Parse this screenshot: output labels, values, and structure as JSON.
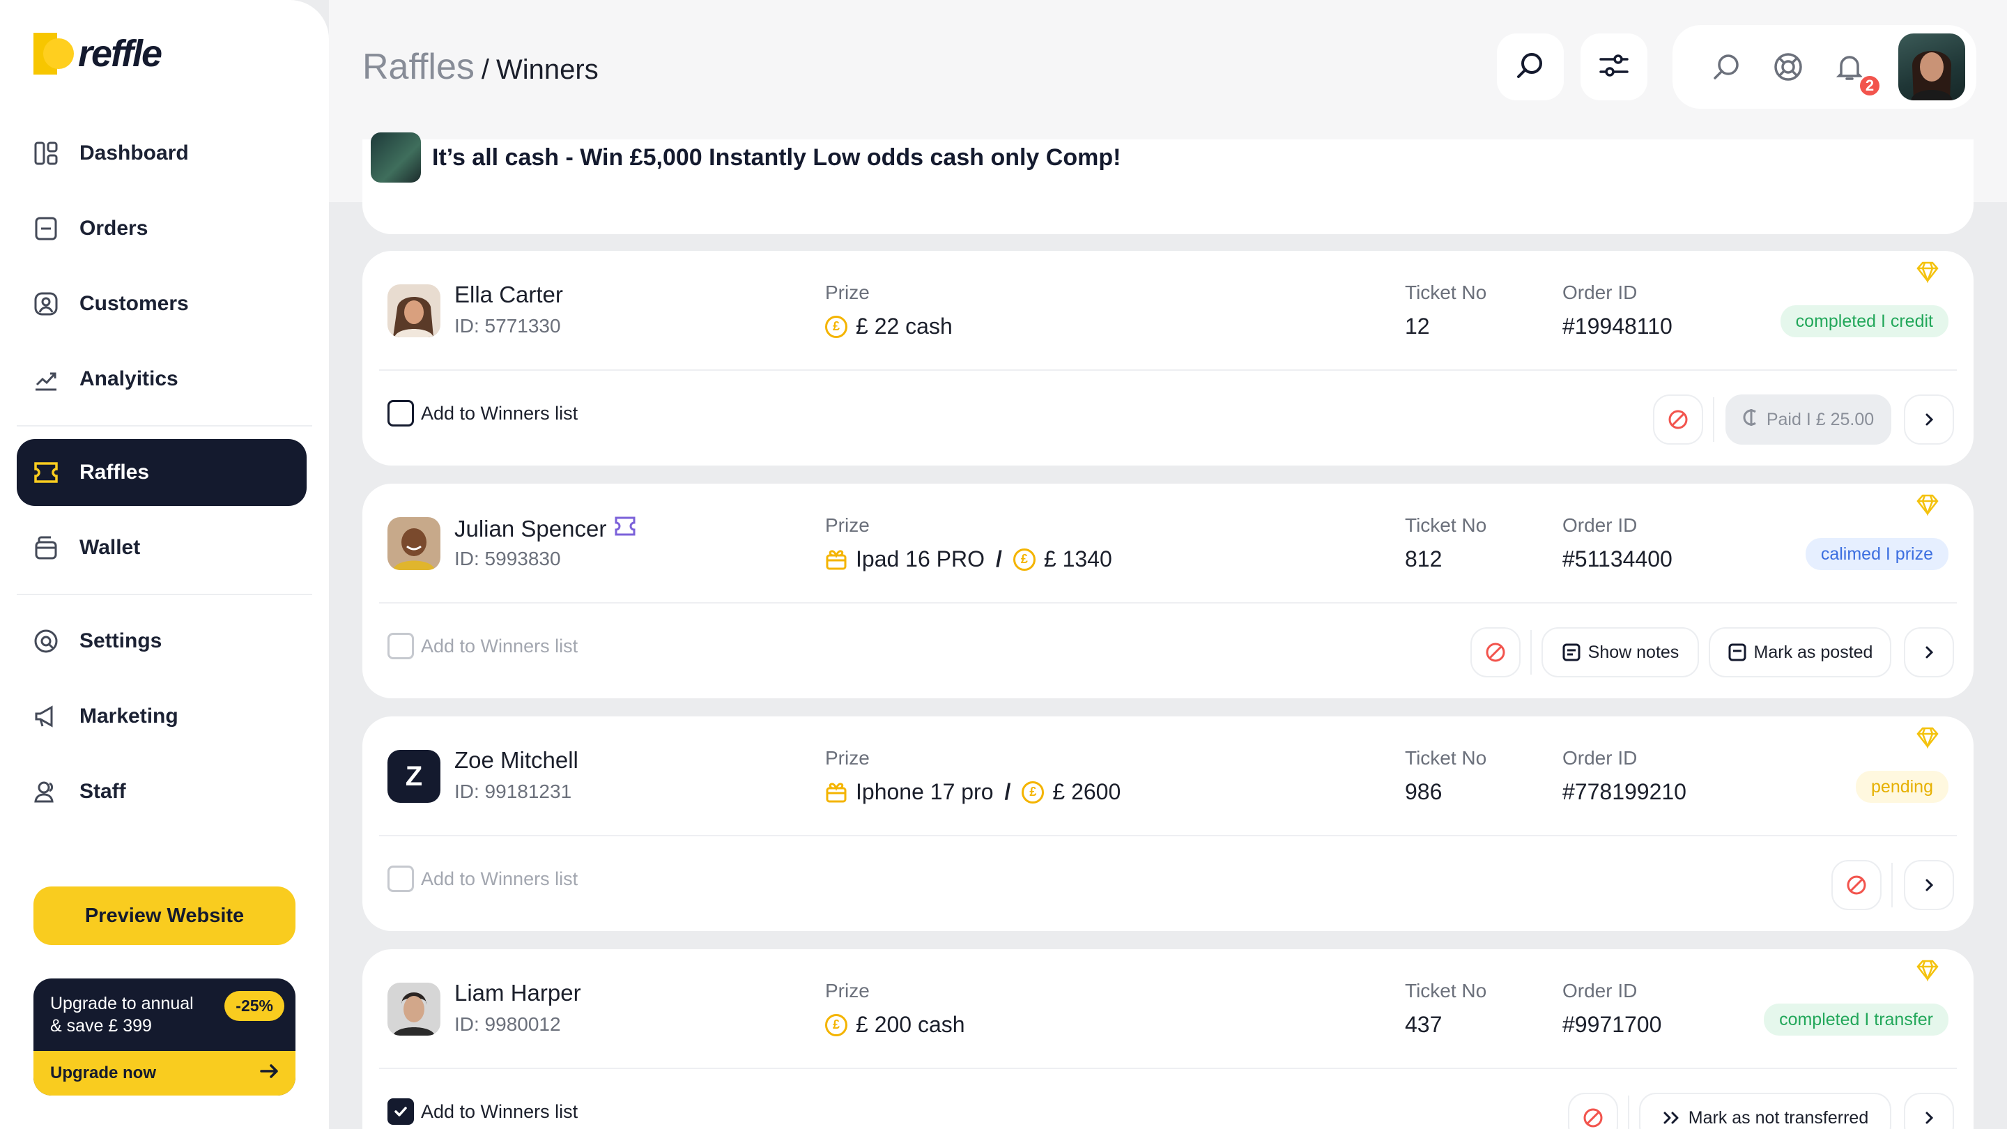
{
  "brand": {
    "name": "reffle"
  },
  "nav": {
    "items": [
      {
        "label": "Dashboard",
        "icon": "dashboard-icon"
      },
      {
        "label": "Orders",
        "icon": "orders-icon"
      },
      {
        "label": "Customers",
        "icon": "customers-icon"
      },
      {
        "label": "Analyitics",
        "icon": "analytics-icon"
      },
      {
        "label": "Raffles",
        "icon": "ticket-icon",
        "active": true
      },
      {
        "label": "Wallet",
        "icon": "wallet-icon"
      },
      {
        "label": "Settings",
        "icon": "settings-icon"
      },
      {
        "label": "Marketing",
        "icon": "megaphone-icon"
      },
      {
        "label": "Staff",
        "icon": "staff-icon"
      }
    ],
    "preview_label": "Preview Website",
    "upgrade": {
      "line1": "Upgrade to annual",
      "line2": "& save £ 399",
      "badge": "-25%",
      "cta": "Upgrade now"
    }
  },
  "header": {
    "breadcrumb_root": "Raffles",
    "breadcrumb_sep": "/",
    "breadcrumb_current": "Winners",
    "notifications_count": "2"
  },
  "raffle": {
    "title": "It’s all cash - Win £5,000 Instantly Low odds cash only Comp!"
  },
  "labels": {
    "prize": "Prize",
    "ticket": "Ticket No",
    "order": "Order ID",
    "add_winners": "Add to Winners list",
    "show_notes": "Show notes",
    "mark_posted": "Mark as posted",
    "mark_not_transferred": "Mark as not transferred"
  },
  "winners": [
    {
      "name": "Ella Carter",
      "id": "ID: 5771330",
      "prize_item": "",
      "prize_cash": "£ 22 cash",
      "ticket": "12",
      "order": "#19948110",
      "status": "completed I credit",
      "status_color": "#22a75a",
      "paid": "Paid I £ 25.00",
      "checked": false,
      "enabled": true
    },
    {
      "name": "Julian Spencer",
      "id": "ID: 5993830",
      "prize_item": "Ipad 16 PRO",
      "prize_cash": "£ 1340",
      "ticket": "812",
      "order": "#51134400",
      "status": "calimed I prize",
      "status_color": "#3c6fe0",
      "checked": false,
      "enabled": false
    },
    {
      "name": "Zoe Mitchell",
      "initial": "Z",
      "id": "ID: 99181231",
      "prize_item": "Iphone 17 pro",
      "prize_cash": "£ 2600",
      "ticket": "986",
      "order": "#778199210",
      "status": "pending",
      "status_color": "#e6b000",
      "checked": false,
      "enabled": false
    },
    {
      "name": "Liam Harper",
      "id": "ID: 9980012",
      "prize_item": "",
      "prize_cash": "£ 200 cash",
      "ticket": "437",
      "order": "#9971700",
      "status": "completed I transfer",
      "status_color": "#22a75a",
      "checked": true,
      "enabled": true
    }
  ],
  "colors": {
    "accent": "#f9cc1f",
    "navy": "#141a2e",
    "danger": "#f2544d"
  }
}
